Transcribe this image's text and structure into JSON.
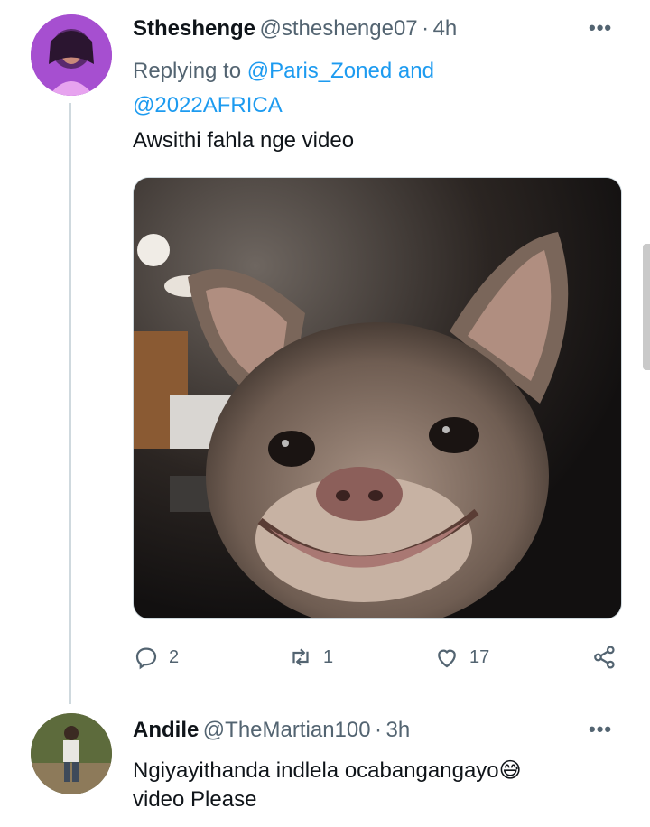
{
  "tweet1": {
    "display_name": "Stheshenge",
    "handle": "@stheshenge07",
    "separator": "·",
    "time": "4h",
    "more_icon": "more-horizontal-icon",
    "replying_prefix": "Replying to",
    "replying_user1": "@Paris_Zoned",
    "replying_and": "and",
    "replying_user2": "@2022AFRICA",
    "text": "Awsithi fahla nge video",
    "actions": {
      "reply_count": "2",
      "retweet_count": "1",
      "like_count": "17"
    }
  },
  "tweet2": {
    "display_name": "Andile",
    "handle": "@TheMartian100",
    "separator": "·",
    "time": "3h",
    "more_icon": "more-horizontal-icon",
    "text_line1": "Ngiyayithanda indlela ocabangangayo",
    "emoji": "😅",
    "text_line2": "video Please"
  },
  "colors": {
    "accent": "#1d9bf0",
    "secondary_text": "#536471",
    "thread_line": "#cfd9de"
  }
}
